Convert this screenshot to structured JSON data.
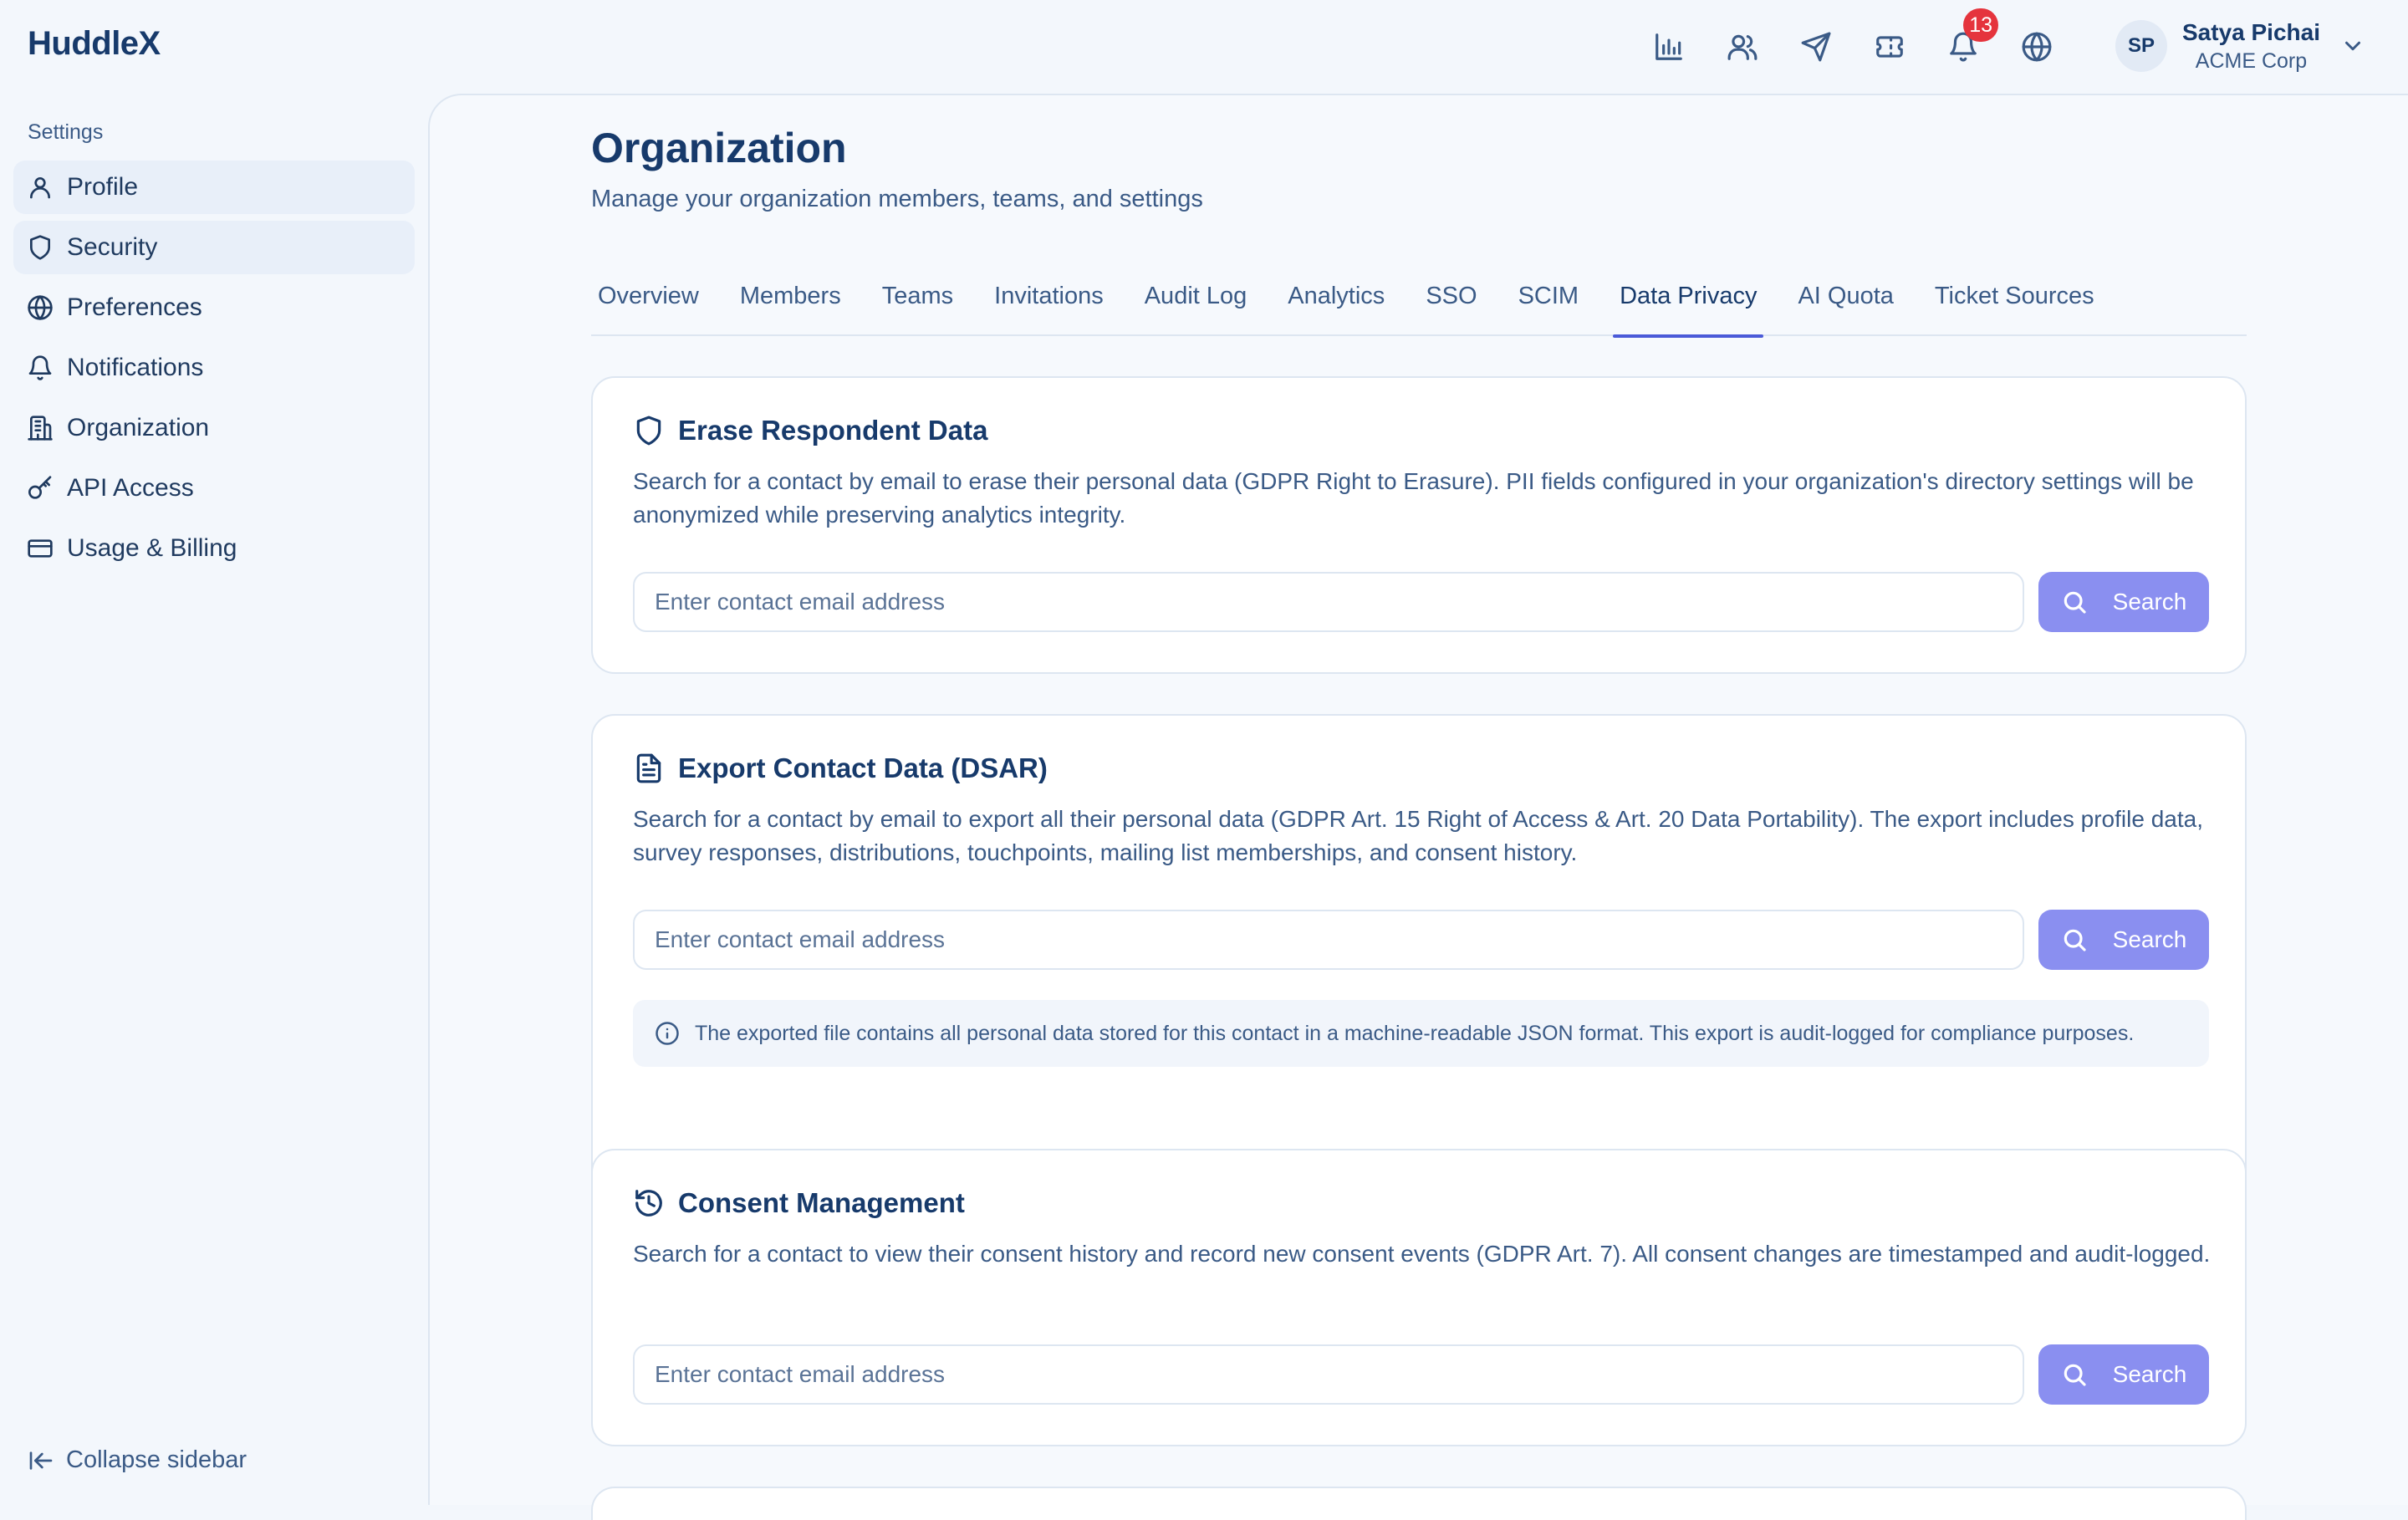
{
  "app": {
    "brand": "HuddleX"
  },
  "header": {
    "icons": [
      "bar-chart-icon",
      "users-icon",
      "send-icon",
      "ticket-icon",
      "bell-icon",
      "globe-icon"
    ],
    "notifications_count": "13",
    "user": {
      "initials": "SP",
      "name": "Satya Pichai",
      "org": "ACME Corp"
    }
  },
  "sidebar": {
    "heading": "Settings",
    "items": [
      {
        "label": "Profile",
        "icon": "user-icon"
      },
      {
        "label": "Security",
        "icon": "shield-icon"
      },
      {
        "label": "Preferences",
        "icon": "globe-icon"
      },
      {
        "label": "Notifications",
        "icon": "bell-icon"
      },
      {
        "label": "Organization",
        "icon": "building-icon"
      },
      {
        "label": "API Access",
        "icon": "key-icon"
      },
      {
        "label": "Usage & Billing",
        "icon": "credit-card-icon"
      }
    ],
    "collapse_label": "Collapse sidebar"
  },
  "main": {
    "title": "Organization",
    "subtitle": "Manage your organization members, teams, and settings",
    "tabs": [
      {
        "label": "Overview"
      },
      {
        "label": "Members"
      },
      {
        "label": "Teams"
      },
      {
        "label": "Invitations"
      },
      {
        "label": "Audit Log"
      },
      {
        "label": "Analytics"
      },
      {
        "label": "SSO"
      },
      {
        "label": "SCIM"
      },
      {
        "label": "Data Privacy"
      },
      {
        "label": "AI Quota"
      },
      {
        "label": "Ticket Sources"
      }
    ],
    "active_tab": "Data Privacy",
    "cards": [
      {
        "title": "Erase Respondent Data",
        "icon": "shield-icon",
        "description": "Search for a contact by email to erase their personal data (GDPR Right to Erasure). PII fields configured in your organization's directory settings will be anonymized while preserving analytics integrity.",
        "input_placeholder": "Enter contact email address",
        "button_label": "Search"
      },
      {
        "title": "Export Contact Data (DSAR)",
        "icon": "file-text-icon",
        "description": "Search for a contact by email to export all their personal data (GDPR Art. 15 Right of Access & Art. 20 Data Portability). The export includes profile data, survey responses, distributions, touchpoints, mailing list memberships, and consent history.",
        "input_placeholder": "Enter contact email address",
        "button_label": "Search",
        "info": "The exported file contains all personal data stored for this contact in a machine-readable JSON format. This export is audit-logged for compliance purposes."
      },
      {
        "title": "Consent Management",
        "icon": "history-icon",
        "description": "Search for a contact to view their consent history and record new consent events (GDPR Art. 7). All consent changes are timestamped and audit-logged.",
        "input_placeholder": "Enter contact email address",
        "button_label": "Search"
      }
    ]
  },
  "colors": {
    "brand": "#173a6b",
    "accent": "#4a5ad8",
    "button": "#8a8ff0",
    "badge": "#e5343d",
    "background": "#f3f7fc"
  }
}
